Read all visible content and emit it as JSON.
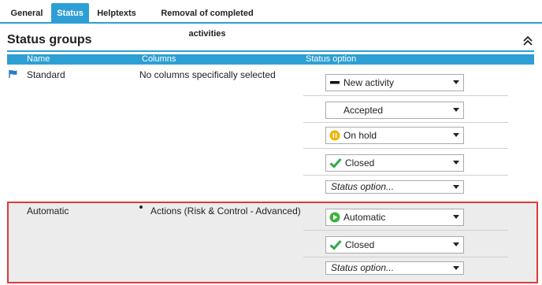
{
  "tabs": [
    {
      "label": "General"
    },
    {
      "label": "Status"
    },
    {
      "label": "Helptexts"
    },
    {
      "label": "Removal of completed activities"
    }
  ],
  "section": {
    "title": "Status groups"
  },
  "table": {
    "headers": {
      "name": "Name",
      "columns": "Columns",
      "status_option": "Status option"
    }
  },
  "groups": [
    {
      "name": "Standard",
      "columns": "No columns specifically selected",
      "options": [
        {
          "label": "New activity",
          "icon": "dash-icon"
        },
        {
          "label": "Accepted",
          "icon": ""
        },
        {
          "label": "On hold",
          "icon": "pause-icon"
        },
        {
          "label": "Closed",
          "icon": "check-icon"
        }
      ],
      "placeholder": "Status option..."
    },
    {
      "name": "Automatic",
      "columns": "Actions (Risk & Control - Advanced)",
      "options": [
        {
          "label": "Automatic",
          "icon": "play-icon"
        },
        {
          "label": "Closed",
          "icon": "check-icon"
        }
      ],
      "placeholder": "Status option..."
    }
  ],
  "colors": {
    "accent": "#2d9fd4",
    "highlight_border": "#e03a3a",
    "pause": "#f0b400",
    "check": "#2fa84f",
    "play": "#3fb33f"
  }
}
